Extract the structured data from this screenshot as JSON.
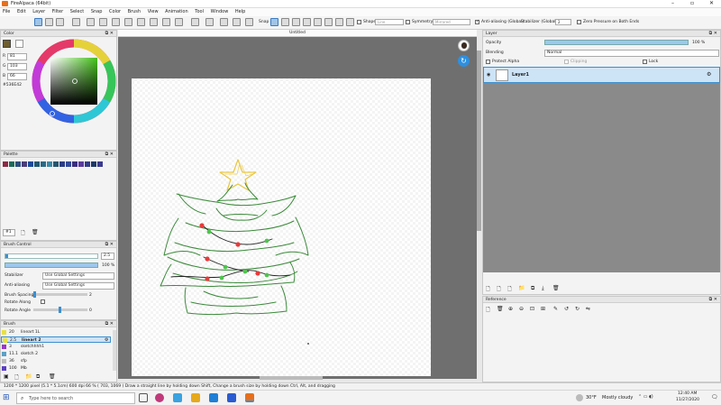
{
  "app": {
    "title": "FireAlpaca (64bit)"
  },
  "menu": [
    "File",
    "Edit",
    "Layer",
    "Filter",
    "Select",
    "Snap",
    "Color",
    "Brush",
    "View",
    "Animation",
    "Tool",
    "Window",
    "Help"
  ],
  "toolbar": {
    "snap_label": "Snap",
    "shape_label": "Shape",
    "shape_value": "Line",
    "symmetry_label": "Symmetry",
    "symmetry_value": "Mirrored",
    "antialias_label": "Anti-aliasing (Global)",
    "stabilizer_label": "Stabilizer (Global)",
    "stabilizer_value": "2",
    "zero_pressure_label": "Zero Pressure on Both Ends"
  },
  "color_panel": {
    "title": "Color",
    "r_label": "R",
    "r_value": "81",
    "g_label": "G",
    "g_value": "103",
    "b_label": "B",
    "b_value": "66",
    "hex": "#536E42"
  },
  "palette_panel": {
    "title": "Palette",
    "set_value": "#1"
  },
  "brush_control": {
    "title": "Brush Control",
    "size_value": "2.5",
    "opacity_value": "100 %",
    "stabilizer_label": "Stabilizer",
    "stabilizer_value": "Use Global Settings",
    "antialias_label": "Anti-aliasing",
    "antialias_value": "Use Global Settings",
    "spacing_label": "Brush Spacing",
    "spacing_value": "2",
    "rotate_along_label": "Rotate Along",
    "rotate_angle_label": "Rotate Angle",
    "rotate_angle_value": "0"
  },
  "brush_panel": {
    "title": "Brush",
    "items": [
      {
        "size": "20",
        "name": "lineart 1L"
      },
      {
        "size": "2.5",
        "name": "lineart 2"
      },
      {
        "size": "3",
        "name": "sketchhhh1"
      },
      {
        "size": "11.1",
        "name": "sketch 2"
      },
      {
        "size": "36",
        "name": "sfp"
      },
      {
        "size": "100",
        "name": "Mb"
      }
    ]
  },
  "canvas": {
    "tab_title": "Untitled"
  },
  "layer_panel": {
    "title": "Layer",
    "opacity_label": "Opacity",
    "opacity_value": "100 %",
    "blending_label": "Blending",
    "blending_value": "Normal",
    "protect_alpha_label": "Protect Alpha",
    "clipping_label": "Clipping",
    "lock_label": "Lock",
    "layers": [
      {
        "name": "Layer1"
      }
    ]
  },
  "reference_panel": {
    "title": "Reference"
  },
  "status": {
    "text": "1200 * 1200 pixel  (5.1 * 5.1cm)  600 dpi  66 %  ( 703, 1069 )  Draw a straight line by holding down Shift, Change a brush size by holding down Ctrl, Alt, and dragging"
  },
  "taskbar": {
    "search_placeholder": "Type here to search",
    "weather_temp": "30°F",
    "weather_text": "Mostly cloudy",
    "time": "12:40 AM",
    "date": "11/27/2020"
  },
  "colors": {
    "primary": "#536E42",
    "accent": "#3b8fd0",
    "selection": "#cde4f7",
    "canvas_bg": "#6f6f6f"
  },
  "palette_swatches": [
    "#8a2b45",
    "#1d6a5a",
    "#2d4f80",
    "#4a3c7a",
    "#1a4a9a",
    "#205870",
    "#2a6a86",
    "#3c8aa8",
    "#24566e",
    "#2a3d86",
    "#324a9a",
    "#3a2f7d",
    "#5a3a9e",
    "#333d8a",
    "#1d3866",
    "#3b3b8f"
  ],
  "brush_colors": [
    "#e8e23c",
    "#e8e23c",
    "#9b37c9",
    "#5aa0c8",
    "#bcbcbc",
    "#5b3ec6"
  ]
}
